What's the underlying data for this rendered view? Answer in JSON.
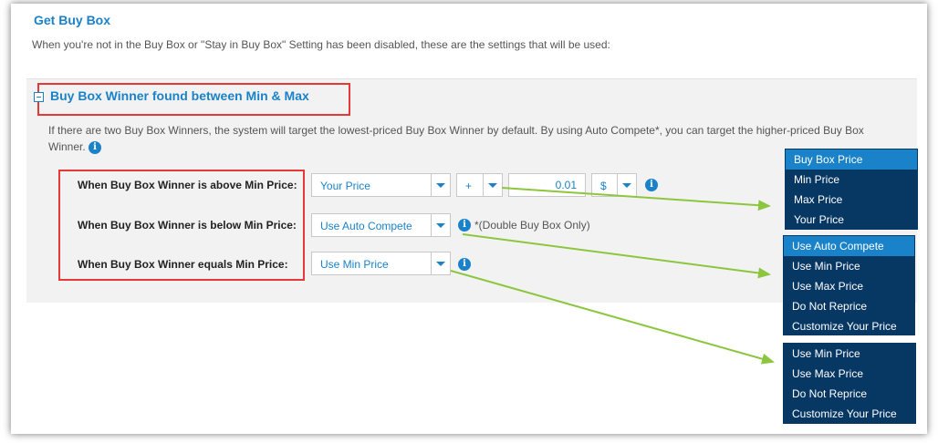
{
  "section": {
    "title": "Get Buy Box",
    "description": "When you're not in the Buy Box or \"Stay in Buy Box\" Setting has been disabled, these are the settings that will be used:"
  },
  "panel": {
    "title": "Buy Box Winner found between Min & Max",
    "info": "If there are two Buy Box Winners, the system will target the lowest-priced Buy Box Winner by default. By using Auto Compete*, you can target the higher-priced Buy Box Winner."
  },
  "rows": {
    "above": {
      "label": "When Buy Box Winner is above Min Price:",
      "select": "Your Price",
      "operator": "+",
      "amount": "0.01",
      "unit": "$"
    },
    "below": {
      "label": "When Buy Box Winner is below Min Price:",
      "select": "Use Auto Compete",
      "note": "*(Double Buy Box Only)"
    },
    "equals": {
      "label": "When Buy Box Winner equals Min Price:",
      "select": "Use Min Price"
    }
  },
  "dropdowns": {
    "above_options": [
      "Buy Box Price",
      "Min Price",
      "Max Price",
      "Your Price"
    ],
    "below_options": [
      "Use Auto Compete",
      "Use Min Price",
      "Use Max Price",
      "Do Not Reprice",
      "Customize Your Price"
    ],
    "equals_options": [
      "Use Min Price",
      "Use Max Price",
      "Do Not Reprice",
      "Customize Your Price"
    ]
  },
  "colors": {
    "accent": "#1a82c8",
    "dropdown_bg": "#073763",
    "highlight": "#e53935",
    "arrow": "#8cc63f"
  },
  "icons": {
    "info": "info-circle-icon",
    "collapse": "minus-square-icon",
    "dropdown": "caret-down-icon"
  }
}
